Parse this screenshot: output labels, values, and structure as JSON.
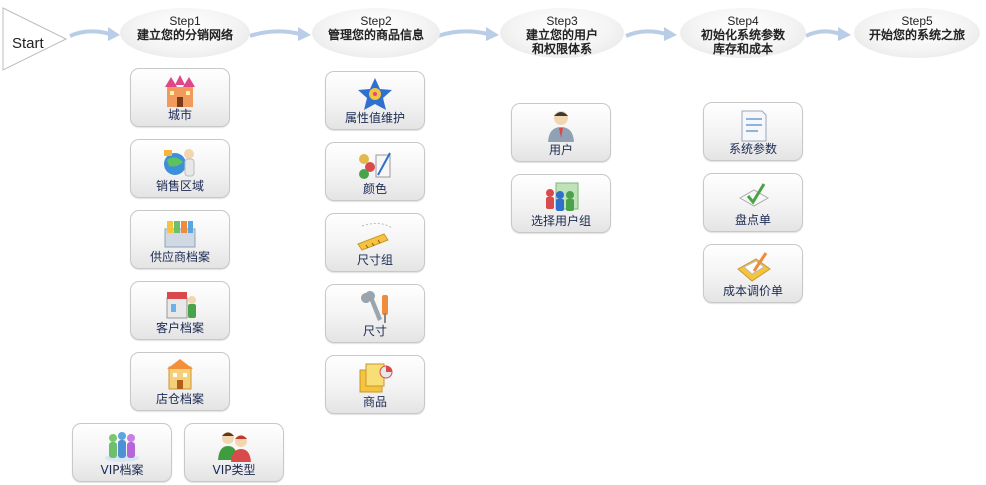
{
  "start": {
    "label": "Start"
  },
  "steps": [
    {
      "num": "Step1",
      "title": "建立您的分销网络"
    },
    {
      "num": "Step2",
      "title": "管理您的商品信息"
    },
    {
      "num": "Step3",
      "title": "建立您的用户\n和权限体系"
    },
    {
      "num": "Step4",
      "title": "初始化系统参数\n库存和成本"
    },
    {
      "num": "Step5",
      "title": "开始您的系统之旅"
    }
  ],
  "tiles": {
    "city": {
      "label": "城市",
      "icon": "city-castle-icon"
    },
    "sales_area": {
      "label": "销售区域",
      "icon": "sales-area-globe-icon"
    },
    "supplier": {
      "label": "供应商档案",
      "icon": "supplier-file-icon"
    },
    "customer": {
      "label": "客户档案",
      "icon": "customer-store-icon"
    },
    "store": {
      "label": "店仓档案",
      "icon": "warehouse-building-icon"
    },
    "vip_file": {
      "label": "VIP档案",
      "icon": "vip-people-icon"
    },
    "vip_type": {
      "label": "VIP类型",
      "icon": "vip-type-people-icon"
    },
    "attribute": {
      "label": "属性值维护",
      "icon": "attribute-star-icon"
    },
    "color": {
      "label": "颜色",
      "icon": "color-paint-icon"
    },
    "size_group": {
      "label": "尺寸组",
      "icon": "size-ruler-icon"
    },
    "size": {
      "label": "尺寸",
      "icon": "size-tools-icon"
    },
    "goods": {
      "label": "商品",
      "icon": "goods-box-icon"
    },
    "user": {
      "label": "用户",
      "icon": "user-person-icon"
    },
    "user_group": {
      "label": "选择用户组",
      "icon": "user-group-icon"
    },
    "sys_params": {
      "label": "系统参数",
      "icon": "system-params-doc-icon"
    },
    "stocktake": {
      "label": "盘点单",
      "icon": "stocktake-check-icon"
    },
    "cost_adjust": {
      "label": "成本调价单",
      "icon": "cost-adjust-folder-icon"
    }
  }
}
